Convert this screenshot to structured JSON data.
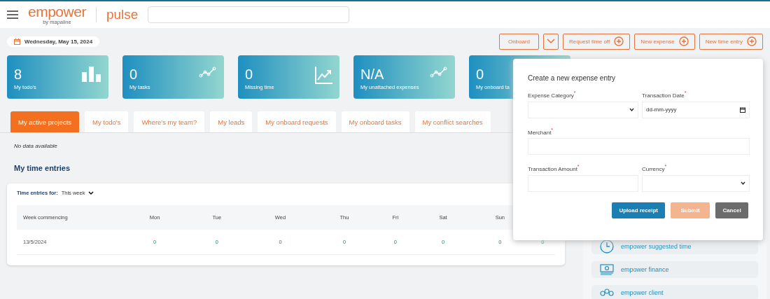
{
  "header": {
    "logo": "empower",
    "logo_tagline": "by mapaline",
    "app_name": "pulse"
  },
  "date": "Wednesday, May 15, 2024",
  "actions": [
    {
      "label": "Onboard",
      "kind": "dropdown"
    },
    {
      "label": "Request time off",
      "kind": "add"
    },
    {
      "label": "New expense",
      "kind": "add"
    },
    {
      "label": "New time entry",
      "kind": "add"
    }
  ],
  "stats": [
    {
      "value": "8",
      "label": "My todo's"
    },
    {
      "value": "0",
      "label": "My tasks"
    },
    {
      "value": "0",
      "label": "Missing time"
    },
    {
      "value": "N/A",
      "label": "My unattached expenses"
    },
    {
      "value": "0",
      "label": "My onboard ta"
    }
  ],
  "tabs": [
    {
      "label": "My active projects",
      "selected": true
    },
    {
      "label": "My todo's",
      "selected": false
    },
    {
      "label": "Where's my team?",
      "selected": false
    },
    {
      "label": "My leads",
      "selected": false
    },
    {
      "label": "My onboard requests",
      "selected": false
    },
    {
      "label": "My onboard tasks",
      "selected": false
    },
    {
      "label": "My conflict searches",
      "selected": false
    }
  ],
  "empty_message": "No data available",
  "time_entries": {
    "title": "My time entries",
    "filter_label": "Time entries for:",
    "filter_value": "This week",
    "columns": [
      "Week commencing",
      "Mon",
      "Tue",
      "Wed",
      "Thu",
      "Fri",
      "Sat",
      "Sun",
      ""
    ],
    "rows": [
      [
        "13/5/2024",
        "0",
        "0",
        "0",
        "0",
        "0",
        "0",
        "0",
        "0"
      ]
    ]
  },
  "sidebar": {
    "items": [
      "empower suggested time",
      "empower finance",
      "empower client"
    ]
  },
  "dialog": {
    "title": "Create a new expense entry",
    "required_mark": "*",
    "fields": [
      {
        "label": "Expense Category",
        "kind": "select",
        "required": true
      },
      {
        "label": "Transaction Date",
        "kind": "date",
        "required": true,
        "placeholder": "dd-mm-yyyy"
      },
      {
        "label": "Merchant",
        "kind": "text",
        "required": true,
        "wide": true
      },
      {
        "label": "Transaction Amount",
        "kind": "text",
        "required": true
      },
      {
        "label": "Currency",
        "kind": "select",
        "required": true
      }
    ],
    "buttons": [
      {
        "label": "Upload receipt",
        "kind": "primary"
      },
      {
        "label": "Submit",
        "kind": "submit",
        "disabled": true
      },
      {
        "label": "Cancel",
        "kind": "secondary"
      }
    ]
  }
}
